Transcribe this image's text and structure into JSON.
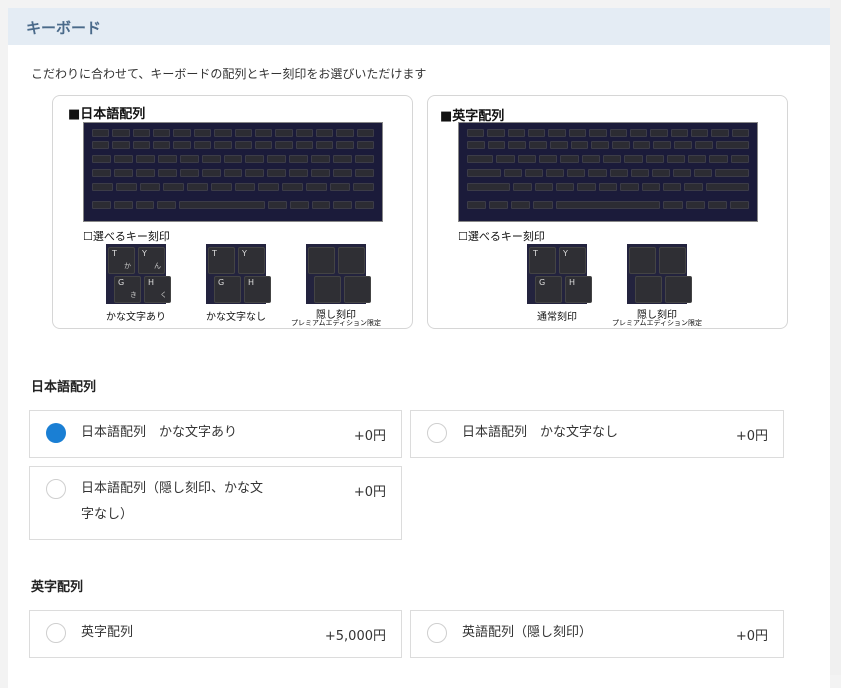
{
  "header": {
    "title": "キーボード"
  },
  "intro": "こだわりに合わせて、キーボードの配列とキー刻印をお選びいただけます",
  "cards": [
    {
      "title": "■日本語配列",
      "selectable_label": "☐選べるキー刻印",
      "zooms": [
        {
          "caption": "かな文字あり",
          "sub": ""
        },
        {
          "caption": "かな文字なし",
          "sub": ""
        },
        {
          "caption": "隠し刻印",
          "sub": "プレミアムエディション限定"
        }
      ]
    },
    {
      "title": "■英字配列",
      "selectable_label": "☐選べるキー刻印",
      "zooms": [
        {
          "caption": "通常刻印",
          "sub": ""
        },
        {
          "caption": "隠し刻印",
          "sub": "プレミアムエディション限定"
        }
      ]
    }
  ],
  "jp_section": {
    "title": "日本語配列",
    "options": [
      {
        "label": "日本語配列　かな文字あり",
        "price": "+0円",
        "checked": true
      },
      {
        "label": "日本語配列　かな文字なし",
        "price": "+0円",
        "checked": false
      },
      {
        "label_line1": "日本語配列（隠し刻印、かな文",
        "label_line2": "字なし）",
        "price": "+0円",
        "checked": false
      }
    ]
  },
  "en_section": {
    "title": "英字配列",
    "options": [
      {
        "label": "英字配列",
        "price": "+5,000円",
        "checked": false
      },
      {
        "label": "英語配列（隠し刻印）",
        "price": "+0円",
        "checked": false
      }
    ]
  },
  "colors": {
    "accent": "#1a7fd4",
    "header_bg": "#e4ecf4",
    "header_text": "#4a6a8a"
  }
}
